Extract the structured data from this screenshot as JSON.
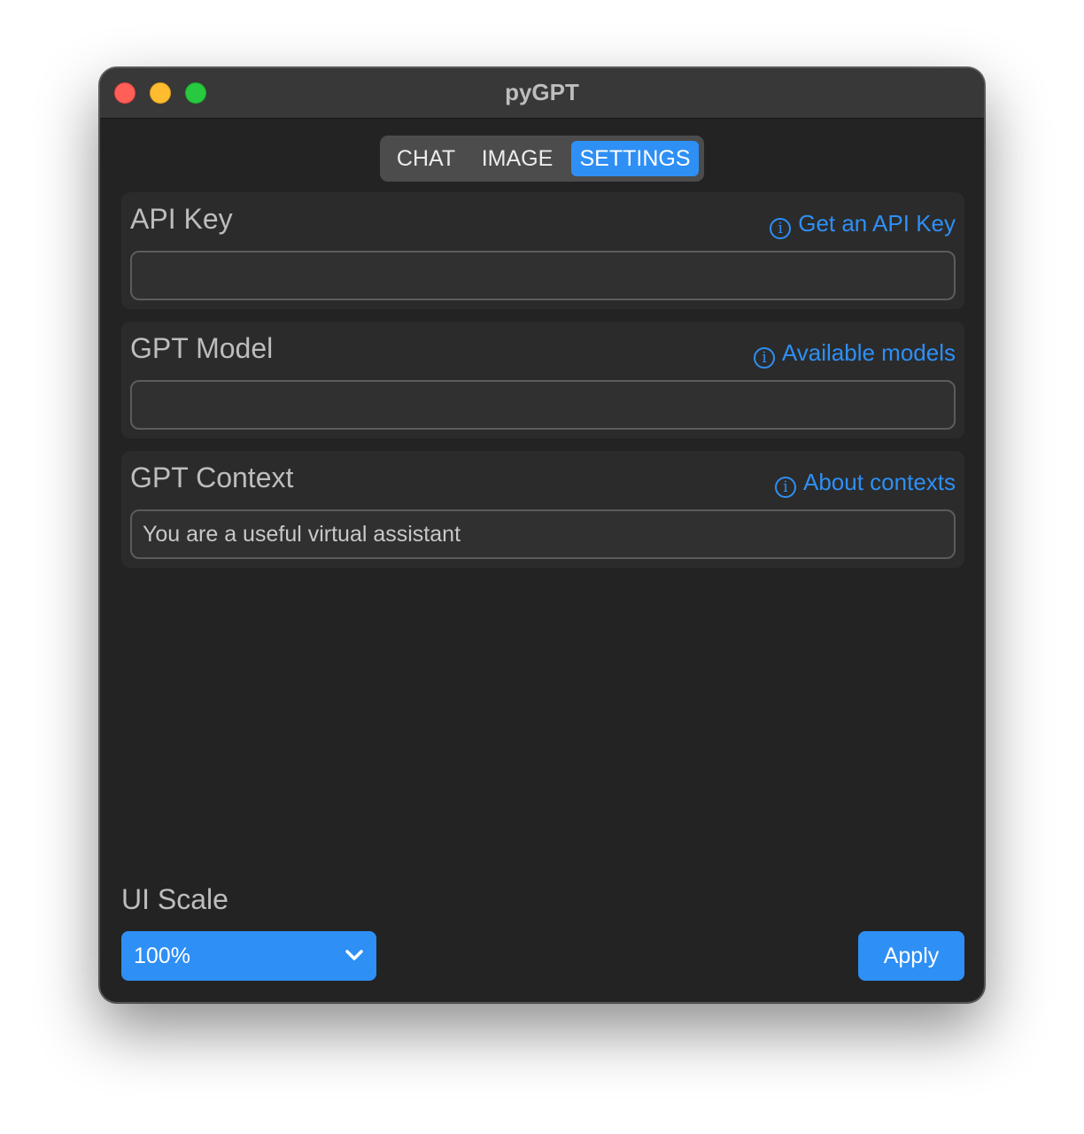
{
  "window": {
    "title": "pyGPT"
  },
  "tabs": [
    {
      "label": "CHAT",
      "selected": false
    },
    {
      "label": "IMAGE",
      "selected": false
    },
    {
      "label": "SETTINGS",
      "selected": true
    }
  ],
  "settings": {
    "api_key": {
      "label": "API Key",
      "link": "Get an API Key",
      "value": ""
    },
    "gpt_model": {
      "label": "GPT Model",
      "link": "Available models",
      "value": ""
    },
    "gpt_context": {
      "label": "GPT Context",
      "link": "About contexts",
      "value": "You are a useful virtual assistant"
    }
  },
  "ui_scale": {
    "label": "UI Scale",
    "selected": "100%"
  },
  "apply_label": "Apply",
  "colors": {
    "accent": "#2e8ff5",
    "window_bg": "#232323",
    "close": "#fe5f57",
    "minimize": "#febc2e",
    "maximize": "#28c840"
  }
}
